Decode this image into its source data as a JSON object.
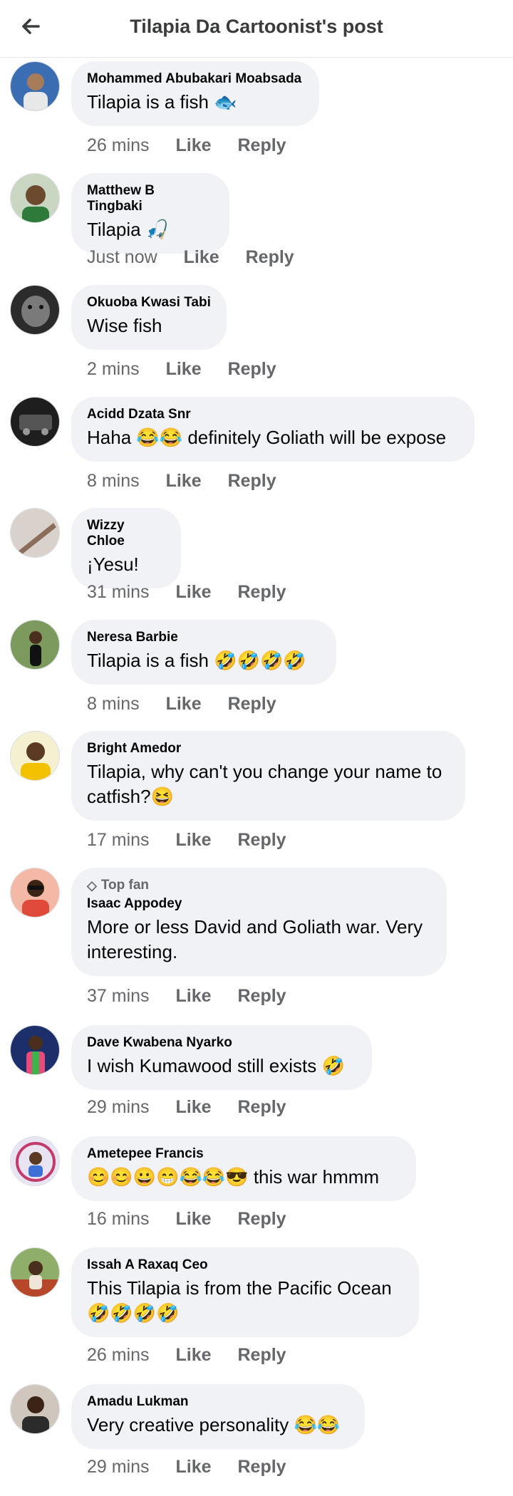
{
  "header": {
    "title": "Tilapia Da Cartoonist's post"
  },
  "like_label": "Like",
  "reply_label": "Reply",
  "comments": [
    {
      "author": "Mohammed Abubakari Moabsada",
      "text": "Tilapia is a fish 🐟",
      "time": "26 mins"
    },
    {
      "author": "Matthew B Tingbaki",
      "text": "Tilapia 🎣",
      "time": "Just now"
    },
    {
      "author": "Okuoba Kwasi Tabi",
      "text": "Wise fish",
      "time": "2 mins"
    },
    {
      "author": "Acidd Dzata Snr",
      "text": "Haha 😂😂 definitely Goliath will be expose",
      "time": "8 mins"
    },
    {
      "author": "Wizzy Chloe",
      "text": "¡Yesu!",
      "time": "31 mins"
    },
    {
      "author": "Neresa Barbie",
      "text": "Tilapia is a fish 🤣🤣🤣🤣",
      "time": "8 mins"
    },
    {
      "author": "Bright Amedor",
      "text": "Tilapia, why can't you change your name to catfish?😆",
      "time": "17 mins"
    },
    {
      "badge": "Top fan",
      "author": "Isaac Appodey",
      "text": "More or less David and Goliath war. Very interesting.",
      "time": "37 mins"
    },
    {
      "author": "Dave Kwabena Nyarko",
      "text": "I wish Kumawood still exists 🤣",
      "time": "29 mins"
    },
    {
      "author": "Ametepee Francis",
      "text": "😊😊😀😁😂😂😎 this war hmmm",
      "time": "16 mins"
    },
    {
      "author": "Issah A Raxaq Ceo",
      "text": "This Tilapia is from the Pacific Ocean 🤣🤣🤣🤣",
      "time": "26 mins"
    },
    {
      "author": "Amadu Lukman",
      "text": "Very creative personality 😂😂",
      "time": "29 mins"
    }
  ]
}
